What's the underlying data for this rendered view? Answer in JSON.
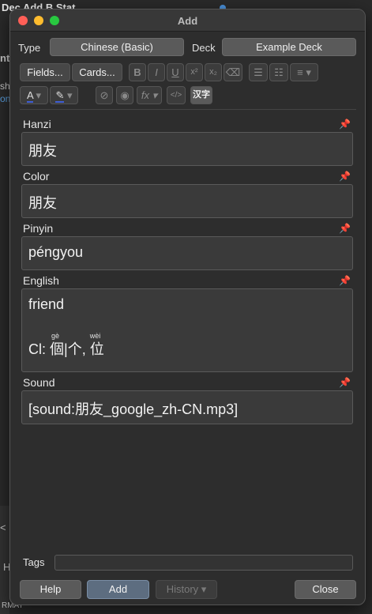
{
  "background": {
    "title_fragment": "Dec    Add    B        Stat",
    "side1": "nt",
    "side2": "sh",
    "side3": "on",
    "bot1": "<",
    "bot2": "H",
    "bot3": "RMAT"
  },
  "window": {
    "title": "Add"
  },
  "type_row": {
    "type_label": "Type",
    "type_value": "Chinese (Basic)",
    "deck_label": "Deck",
    "deck_value": "Example Deck"
  },
  "toolbar": {
    "fields_label": "Fields...",
    "cards_label": "Cards...",
    "bold": "B",
    "italic": "I",
    "underline": "U",
    "superscript": "x²",
    "subscript": "x₂",
    "eraser": "⌫",
    "ul": "☰",
    "ol": "☷",
    "align": "≡",
    "text_color": "A",
    "highlight": "✎",
    "attach": "⊘",
    "mic": "◉",
    "math": "fx",
    "html": "</>",
    "hanzi": "汉字"
  },
  "fields": [
    {
      "label": "Hanzi",
      "value": "朋友"
    },
    {
      "label": "Color",
      "value": "朋友"
    },
    {
      "label": "Pinyin",
      "value": "péngyou"
    },
    {
      "label": "English",
      "value": "friend",
      "cl_prefix": "Cl: ",
      "cl_char1": "個",
      "cl_sep": "|",
      "cl_char2": "个",
      "cl_comma": ", ",
      "cl_char3": "位",
      "anno1": "gè",
      "anno2": "wèi"
    },
    {
      "label": "Sound",
      "value": "[sound:朋友_google_zh-CN.mp3]"
    }
  ],
  "tags": {
    "label": "Tags",
    "value": ""
  },
  "buttons": {
    "help": "Help",
    "add": "Add",
    "history": "History ▾",
    "close": "Close"
  }
}
